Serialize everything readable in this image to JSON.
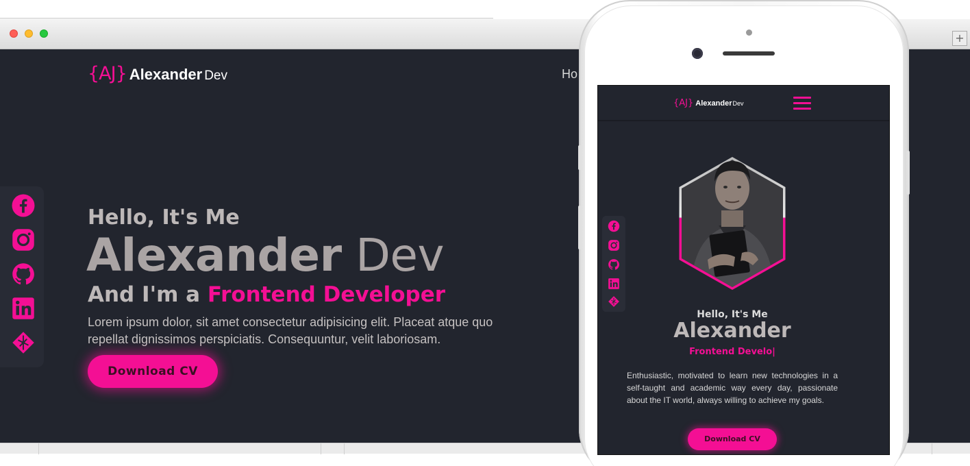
{
  "desktop": {
    "logo": {
      "mark": "{AJ}",
      "name": "Alexander",
      "suffix": "Dev"
    },
    "nav_partial": "Ho",
    "social_icons": [
      "facebook-icon",
      "instagram-icon",
      "github-icon",
      "linkedin-icon",
      "netlify-icon"
    ],
    "hero": {
      "greeting": "Hello, It's Me",
      "name_first": "Alexander",
      "name_last": "Dev",
      "role_prefix": "And I'm a",
      "role_highlight": "Frontend Developer",
      "description": "Lorem ipsum dolor, sit amet consectetur adipisicing elit. Placeat atque quo repellat dignissimos perspiciatis. Consequuntur, velit laboriosam.",
      "cta_label": "Download CV"
    },
    "window_plus": "+"
  },
  "mobile": {
    "logo": {
      "mark": "{AJ}",
      "name": "Alexander",
      "suffix": "Dev"
    },
    "social_icons": [
      "facebook-icon",
      "instagram-icon",
      "github-icon",
      "linkedin-icon",
      "netlify-icon"
    ],
    "greeting": "Hello, It's Me",
    "name": "Alexander",
    "role_typing": "Frontend Develo|",
    "description": "Enthusiastic, motivated to learn new technologies in a self-taught and academic way every day, passionate about the IT world, always willing to achieve my goals.",
    "cta_label": "Download CV"
  },
  "colors": {
    "accent": "#f40f94",
    "background": "#22252e",
    "text_muted": "#aaa4a4"
  }
}
